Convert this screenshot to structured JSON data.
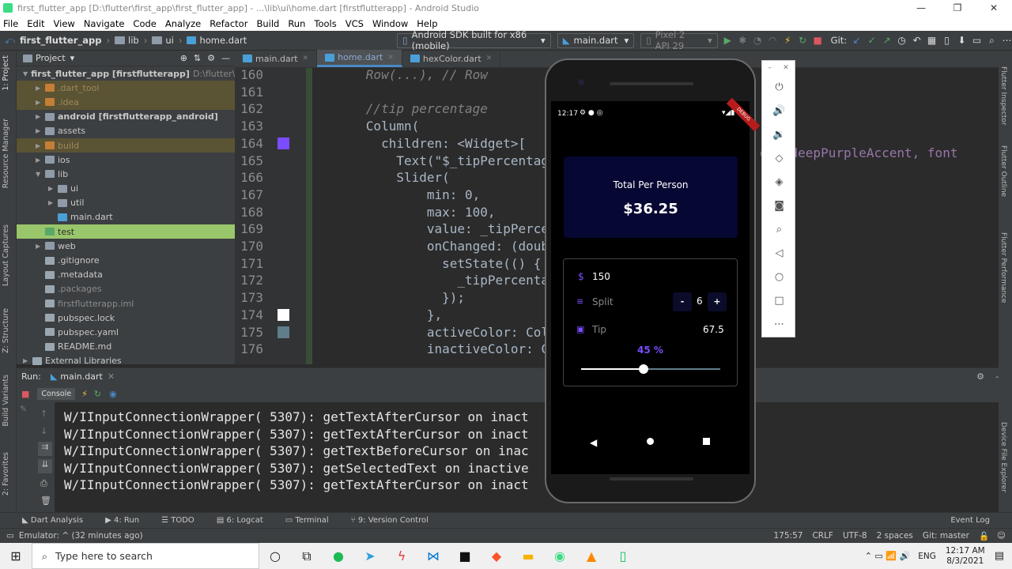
{
  "title_bar": {
    "text": "first_flutter_app [D:\\flutter\\first_app\\first_flutter_app] - ...\\lib\\ui\\home.dart [firstflutterapp] - Android Studio"
  },
  "menu": [
    "File",
    "Edit",
    "View",
    "Navigate",
    "Code",
    "Analyze",
    "Refactor",
    "Build",
    "Run",
    "Tools",
    "VCS",
    "Window",
    "Help"
  ],
  "nav": {
    "crumbs": [
      "first_flutter_app",
      "lib",
      "ui",
      "home.dart"
    ],
    "device_combo": "Android SDK built for x86 (mobile)",
    "config_combo": "main.dart",
    "avd_combo": "Pixel 2 API 29",
    "git_label": "Git:"
  },
  "project": {
    "header": "Project",
    "rows": [
      {
        "label": "first_flutter_app [firstflutterapp]",
        "suffix": "D:\\flutter\\first",
        "level": 0,
        "arrow": "down",
        "kind": "root"
      },
      {
        "label": ".dart_tool",
        "level": 1,
        "arrow": "right",
        "kind": "excluded"
      },
      {
        "label": ".idea",
        "level": 1,
        "arrow": "right",
        "kind": "excluded"
      },
      {
        "label": "android [firstflutterapp_android]",
        "level": 1,
        "arrow": "right",
        "kind": "bold"
      },
      {
        "label": "assets",
        "level": 1,
        "arrow": "right",
        "kind": "folder"
      },
      {
        "label": "build",
        "level": 1,
        "arrow": "right",
        "kind": "excluded"
      },
      {
        "label": "ios",
        "level": 1,
        "arrow": "right",
        "kind": "folder"
      },
      {
        "label": "lib",
        "level": 1,
        "arrow": "down",
        "kind": "folder"
      },
      {
        "label": "ui",
        "level": 2,
        "arrow": "right",
        "kind": "folder"
      },
      {
        "label": "util",
        "level": 2,
        "arrow": "right",
        "kind": "folder"
      },
      {
        "label": "main.dart",
        "level": 2,
        "arrow": "",
        "kind": "dart"
      },
      {
        "label": "test",
        "level": 1,
        "arrow": "",
        "kind": "test"
      },
      {
        "label": "web",
        "level": 1,
        "arrow": "right",
        "kind": "folder"
      },
      {
        "label": ".gitignore",
        "level": 1,
        "arrow": "",
        "kind": "file"
      },
      {
        "label": ".metadata",
        "level": 1,
        "arrow": "",
        "kind": "file"
      },
      {
        "label": ".packages",
        "level": 1,
        "arrow": "",
        "kind": "dim"
      },
      {
        "label": "firstflutterapp.iml",
        "level": 1,
        "arrow": "",
        "kind": "dim"
      },
      {
        "label": "pubspec.lock",
        "level": 1,
        "arrow": "",
        "kind": "file"
      },
      {
        "label": "pubspec.yaml",
        "level": 1,
        "arrow": "",
        "kind": "file"
      },
      {
        "label": "README.md",
        "level": 1,
        "arrow": "",
        "kind": "file"
      },
      {
        "label": "External Libraries",
        "level": 0,
        "arrow": "right",
        "kind": "file"
      }
    ]
  },
  "editor": {
    "tabs": [
      {
        "label": "main.dart",
        "active": false
      },
      {
        "label": "home.dart",
        "active": true
      },
      {
        "label": "hexColor.dart",
        "active": false
      }
    ],
    "lines": [
      {
        "num": "160",
        "code": "      Row(...), // Row",
        "color": "#808080"
      },
      {
        "num": "161",
        "code": "",
        "color": "#a9b7c6"
      },
      {
        "num": "162",
        "code": "      //tip percentage",
        "color": "#808080"
      },
      {
        "num": "163",
        "code": "      Column(",
        "color": "#a9b7c6"
      },
      {
        "num": "164",
        "code": "        children: <Widget>[",
        "color": "#a9b7c6"
      },
      {
        "num": "165",
        "code": "          Text(\"$_tipPercentage",
        "color": "#a9b7c6"
      },
      {
        "num": "166",
        "code": "          Slider(",
        "color": "#a9b7c6"
      },
      {
        "num": "167",
        "code": "              min: 0,",
        "color": "#a9b7c6"
      },
      {
        "num": "168",
        "code": "              max: 100,",
        "color": "#a9b7c6"
      },
      {
        "num": "169",
        "code": "              value: _tipPercent",
        "color": "#a9b7c6"
      },
      {
        "num": "170",
        "code": "              onChanged: (double",
        "color": "#a9b7c6"
      },
      {
        "num": "171",
        "code": "                setState(() {",
        "color": "#a9b7c6"
      },
      {
        "num": "172",
        "code": "                  _tipPercentage",
        "color": "#a9b7c6"
      },
      {
        "num": "173",
        "code": "                });",
        "color": "#a9b7c6"
      },
      {
        "num": "174",
        "code": "              },",
        "color": "#a9b7c6"
      },
      {
        "num": "175",
        "code": "              activeColor: Color",
        "color": "#a9b7c6"
      },
      {
        "num": "176",
        "code": "              inactiveColor: Col",
        "color": "#a9b7c6"
      }
    ],
    "right_snippet": "ors.deepPurpleAccent, font",
    "swatch_colors": [
      "#7c4dff",
      "#ffffff",
      "#607d8b"
    ]
  },
  "run": {
    "label": "Run:",
    "config": "main.dart",
    "console_tab": "Console",
    "lines": [
      "W/IInputConnectionWrapper( 5307): getTextAfterCursor on inact",
      "W/IInputConnectionWrapper( 5307): getTextAfterCursor on inact",
      "W/IInputConnectionWrapper( 5307): getTextBeforeCursor on inac",
      "W/IInputConnectionWrapper( 5307): getSelectedText on inactive",
      "W/IInputConnectionWrapper( 5307): getTextAfterCursor on inact"
    ]
  },
  "bottom_tabs": [
    "Dart Analysis",
    "4: Run",
    "TODO",
    "6: Logcat",
    "Terminal",
    "9: Version Control"
  ],
  "event_log": "Event Log",
  "status": {
    "message": "Emulator: ^ (32 minutes ago)",
    "position": "175:57",
    "line_sep": "CRLF",
    "encoding": "UTF-8",
    "indent": "2 spaces",
    "git": "Git: master"
  },
  "left_strip": [
    "1: Project",
    "Resource Manager",
    "Layout Captures",
    "Z: Structure",
    "Build Variants",
    "2: Favorites"
  ],
  "right_strip": [
    "Flutter Inspector",
    "Flutter Outline",
    "Flutter Performance",
    "Device File Explorer"
  ],
  "phone": {
    "time": "12:17",
    "debug_banner": "DEBUG",
    "total_label": "Total Per Person",
    "total_value": "$36.25",
    "bill_prefix": "$",
    "bill_value": "150",
    "split_label": "Split",
    "split_minus": "-",
    "split_value": "6",
    "split_plus": "+",
    "tip_label": "Tip",
    "tip_value": "67.5",
    "tip_percent": "45 %",
    "slider_fraction": 0.45,
    "colors": {
      "card_bg": "#070733",
      "accent": "#7c4dff"
    }
  },
  "taskbar": {
    "search_placeholder": "Type here to search",
    "language": "ENG",
    "time": "12:17 AM",
    "date": "8/3/2021"
  }
}
